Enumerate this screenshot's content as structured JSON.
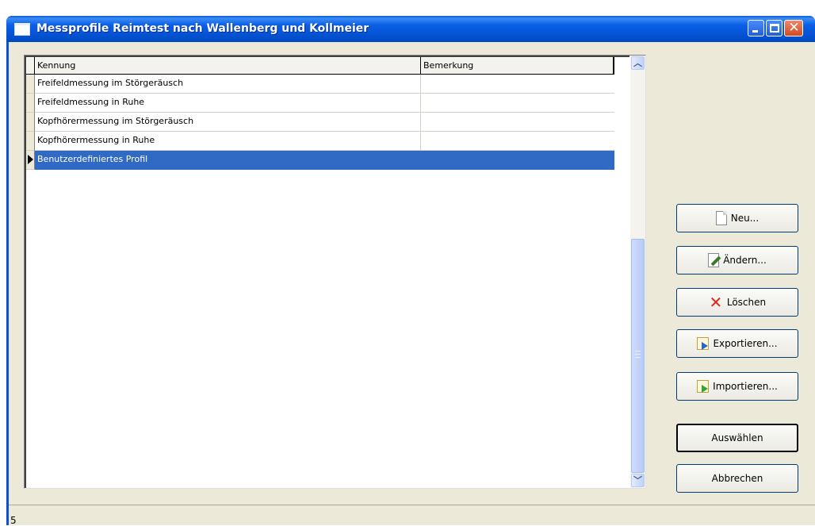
{
  "window": {
    "title": "Messprofile Reimtest nach Wallenberg und Kollmeier"
  },
  "grid": {
    "columns": [
      "Kennung",
      "Bemerkung"
    ],
    "rows": [
      {
        "kennung": "Freifeldmessung im Störgeräusch",
        "bemerkung": ""
      },
      {
        "kennung": "Freifeldmessung in Ruhe",
        "bemerkung": ""
      },
      {
        "kennung": "Kopfhörermessung im Störgeräusch",
        "bemerkung": ""
      },
      {
        "kennung": "Kopfhörermessung in Ruhe",
        "bemerkung": ""
      },
      {
        "kennung": "Benutzerdefiniertes Profil",
        "bemerkung": ""
      }
    ],
    "selected_row": 4
  },
  "buttons": {
    "neu": "Neu...",
    "aendern": "Ändern...",
    "loeschen": "Löschen",
    "exportieren": "Exportieren...",
    "importieren": "Importieren...",
    "auswaehlen": "Auswählen",
    "abbrechen": "Abbrechen"
  },
  "icons": {
    "neu": "new-document-icon",
    "aendern": "edit-icon",
    "loeschen": "delete-icon",
    "exportieren": "export-icon",
    "importieren": "import-icon"
  },
  "status": {
    "text": "5"
  },
  "colors": {
    "selection": "#316ac5",
    "titlebar": "#0a5fe6"
  }
}
